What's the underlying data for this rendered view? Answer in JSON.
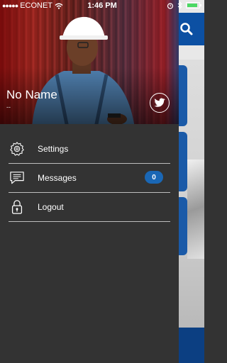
{
  "status_bar": {
    "carrier": "ECONET",
    "signal_dots": "●●●●●",
    "time": "1:46 PM",
    "battery_level": 0.75
  },
  "profile": {
    "name": "No Name",
    "subtitle": "--"
  },
  "menu": {
    "items": [
      {
        "label": "Settings",
        "icon": "settings-icon"
      },
      {
        "label": "Messages",
        "icon": "messages-icon",
        "badge": "0"
      },
      {
        "label": "Logout",
        "icon": "lock-icon"
      }
    ]
  },
  "colors": {
    "drawer_background": "#333333",
    "accent_blue": "#1a67b5",
    "divider": "#bdbdbd",
    "app_bar_blue": "#0c50a3"
  }
}
